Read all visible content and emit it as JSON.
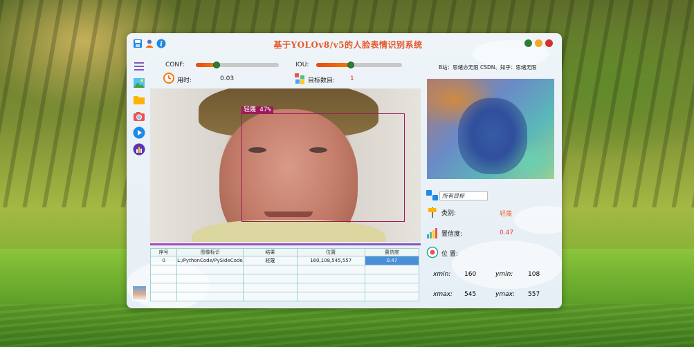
{
  "window": {
    "title": "基于YOLOv8/v5的人脸表情识别系统",
    "credit": "B站：思绪亦无限 CSDN、知乎：思绪无限"
  },
  "colors": {
    "accent": "#e8572a",
    "close": "#d32f2f",
    "minimize": "#f5a623",
    "maximize": "#2e7d32",
    "box": "#9c1a5c"
  },
  "controls": {
    "conf_label": "CONF:",
    "conf_value": 0.25,
    "iou_label": "IOU:",
    "iou_value": 0.4,
    "time_label": "用时:",
    "time_value": "0.03",
    "count_label": "目标数目:",
    "count_value": "1"
  },
  "detection": {
    "label": "轻蔑 47%"
  },
  "table": {
    "headers": [
      "序号",
      "图像标识",
      "结果",
      "位置",
      "置信度"
    ],
    "rows": [
      [
        "0",
        "L:/PythonCode/PySideCode/...",
        "轻蔑",
        "160,108,545,557",
        "0.47"
      ]
    ]
  },
  "info": {
    "filter_value": "所有目标",
    "class_label": "类别:",
    "class_value": "轻蔑",
    "conf_label": "置信度:",
    "conf_value": "0.47",
    "pos_label": "位 置:",
    "xmin_label": "xmin:",
    "xmin_value": "160",
    "ymin_label": "ymin:",
    "ymin_value": "108",
    "xmax_label": "xmax:",
    "xmax_value": "545",
    "ymax_label": "ymax:",
    "ymax_value": "557"
  },
  "icons": [
    "save-icon",
    "user-icon",
    "info-icon",
    "menu-icon",
    "image-icon",
    "folder-icon",
    "camera-icon",
    "play-icon",
    "chart-icon",
    "timer-icon",
    "target-count-icon",
    "class-icon",
    "confidence-icon",
    "position-icon"
  ]
}
